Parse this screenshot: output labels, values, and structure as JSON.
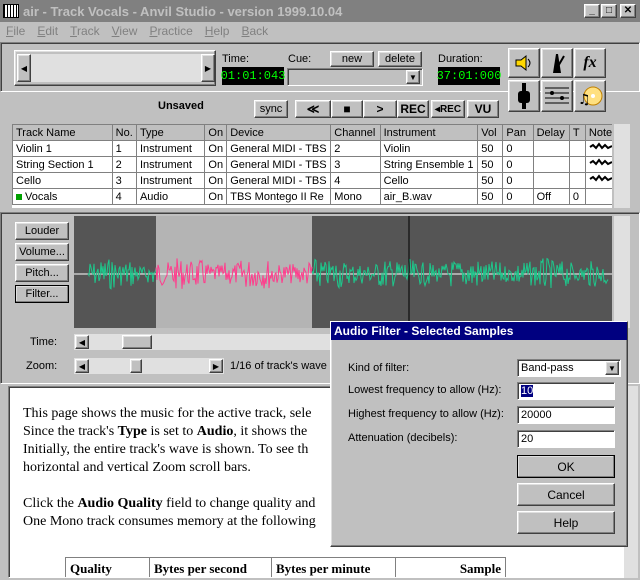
{
  "window": {
    "title": "air - Track Vocals - Anvil Studio - version 1999.10.04"
  },
  "menu": [
    {
      "label": "File",
      "key": "F",
      "rest": "ile"
    },
    {
      "label": "Edit",
      "key": "E",
      "rest": "dit"
    },
    {
      "label": "Track",
      "key": "T",
      "rest": "rack"
    },
    {
      "label": "View",
      "key": "V",
      "rest": "iew"
    },
    {
      "label": "Practice",
      "key": "P",
      "rest": "ractice"
    },
    {
      "label": "Help",
      "key": "H",
      "rest": "elp"
    },
    {
      "label": "Back",
      "key": "B",
      "rest": "ack"
    }
  ],
  "transport": {
    "time_label": "Time:",
    "time_value": "01:01:043",
    "cue_label": "Cue:",
    "new_label": "new",
    "delete_label": "delete",
    "duration_label": "Duration:",
    "duration_value": "37:01:000",
    "status": "Unsaved",
    "sync_label": "sync",
    "rew_label": "≪",
    "stop_label": "■",
    "play_label": ">",
    "rec_label": "REC",
    "rerec_label": "◂REC",
    "vu_label": "VU"
  },
  "tracks": {
    "headers": [
      "Track Name",
      "No.",
      "Type",
      "On",
      "Device",
      "Channel",
      "Instrument",
      "Vol",
      "Pan",
      "Delay",
      "T",
      "Notes"
    ],
    "rows": [
      {
        "name": "Violin 1",
        "no": "1",
        "type": "Instrument",
        "on": "On",
        "device": "General MIDI - TBS",
        "channel": "2",
        "instrument": "Violin",
        "vol": "50",
        "pan": "0",
        "delay": "",
        "t": ""
      },
      {
        "name": "String Section 1",
        "no": "2",
        "type": "Instrument",
        "on": "On",
        "device": "General MIDI - TBS",
        "channel": "3",
        "instrument": "String Ensemble 1",
        "vol": "50",
        "pan": "0",
        "delay": "",
        "t": ""
      },
      {
        "name": "Cello",
        "no": "3",
        "type": "Instrument",
        "on": "On",
        "device": "General MIDI - TBS",
        "channel": "4",
        "instrument": "Cello",
        "vol": "50",
        "pan": "0",
        "delay": "",
        "t": ""
      },
      {
        "name": "Vocals",
        "no": "4",
        "type": "Audio",
        "on": "On",
        "device": "TBS Montego II Re",
        "channel": "Mono",
        "instrument": "air_B.wav",
        "vol": "50",
        "pan": "0",
        "delay": "Off",
        "t": "0"
      }
    ]
  },
  "editor": {
    "louder": "Louder",
    "volume": "Volume...",
    "pitch": "Pitch...",
    "filter": "Filter...",
    "time_label": "Time:",
    "zoom_label": "Zoom:",
    "zoom_text": "1/16 of track's wave"
  },
  "help": {
    "p1": [
      {
        "t": "This page shows the music for the active track, sele"
      },
      {
        "t": "Since the track's "
      },
      {
        "b": "Type"
      },
      {
        "t": " is set to "
      },
      {
        "b": "Audio"
      },
      {
        "t": ", it shows the"
      },
      {
        "t": "Initially, the entire track's wave is shown. To see th"
      },
      {
        "t": "horizontal and vertical Zoom scroll bars."
      }
    ],
    "line1": "This page shows the music for the active track, sele",
    "line2a": "Since the track's ",
    "line2b": "Type",
    "line2c": " is set to ",
    "line2d": "Audio",
    "line2e": ", it shows the",
    "line3": "Initially, the entire track's wave is shown. To see th",
    "line4": "horizontal and vertical Zoom scroll bars.",
    "line5a": "Click the ",
    "line5b": "Audio Quality",
    "line5c": " field to change quality and",
    "line6": "One Mono track consumes memory at the following",
    "table_headers": [
      "Quality",
      "Bytes per second",
      "Bytes per minute",
      "Sample"
    ]
  },
  "dialog": {
    "title": "Audio Filter - Selected Samples",
    "kind_label": "Kind of filter:",
    "kind_value": "Band-pass",
    "low_label": "Lowest frequency to allow (Hz):",
    "low_value": "10",
    "high_label": "Highest frequency to allow (Hz):",
    "high_value": "20000",
    "atten_label": "Attenuation (decibels):",
    "atten_value": "20",
    "ok": "OK",
    "cancel": "Cancel",
    "help": "Help"
  },
  "colors": {
    "wave_selected": "#ff3c8c",
    "wave_normal": "#1ec88c",
    "selection_bg": "#b4b4b4",
    "title_inactive": "#808080",
    "dialog_title": "#000080"
  }
}
